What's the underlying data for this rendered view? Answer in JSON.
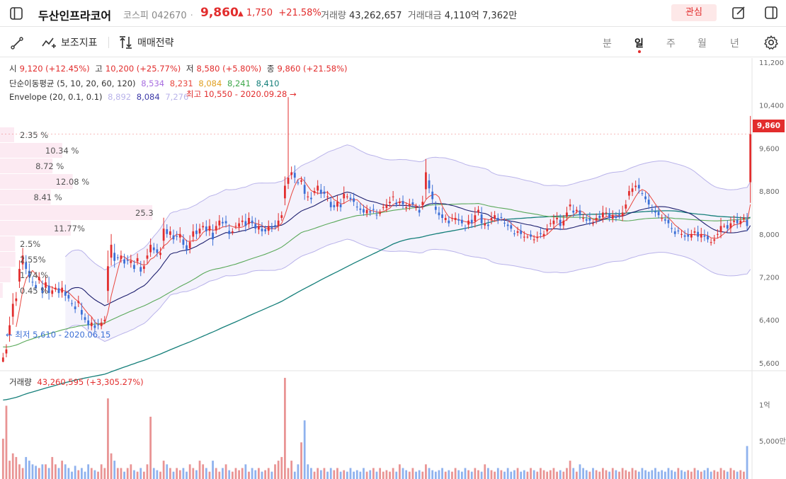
{
  "header": {
    "name": "두산인프라코어",
    "market": "코스피",
    "code": "042670",
    "price": "9,860",
    "change_arrow": "▲",
    "change_amount": "1,750",
    "change_pct": "+21.58%",
    "volume_label": "거래량",
    "volume_value": "43,262,657",
    "amount_label": "거래대금",
    "amount_value": "4,110억 7,362만",
    "fav_label": "관심"
  },
  "toolbar": {
    "indicator_label": "보조지표",
    "strategy_label": "매매전략",
    "periods": [
      "분",
      "일",
      "주",
      "월",
      "년"
    ],
    "active_period": "일"
  },
  "legend": {
    "ohlc": [
      {
        "label": "시",
        "value": "9,120 (+12.45%)"
      },
      {
        "label": "고",
        "value": "10,200 (+25.77%)"
      },
      {
        "label": "저",
        "value": "8,580 (+5.80%)"
      },
      {
        "label": "종",
        "value": "9,860 (+21.58%)"
      }
    ],
    "ma_label": "단순이동평균 (5, 10, 20, 60, 120)",
    "ma_values": [
      "8,534",
      "8,231",
      "8,084",
      "8,241",
      "8,410"
    ],
    "env_label": "Envelope (20, 0.1, 0.1)",
    "env_values": [
      "8,892",
      "8,084",
      "7,276"
    ]
  },
  "annotations": {
    "high": "최고 10,550 - 2020.09.28",
    "low": "최저 5,610 - 2020.06.15",
    "current_price": "9,860",
    "volume_title": "거래량",
    "volume_value": "43,260,595 (+3,305.27%)"
  },
  "colors": {
    "up": "#e22d2d",
    "down": "#3b6fd6",
    "ma5": "#e8473f",
    "ma10": "#1d1f6e",
    "ma20": "#5aa95a",
    "ma60": "#157f7a",
    "envelope": "#b9b3ea",
    "vol_up": "#e99494",
    "vol_down": "#8fb2ee"
  },
  "chart_data": {
    "type": "candlestick",
    "y_axis": {
      "ticks": [
        "11,200",
        "10,400",
        "9,600",
        "8,800",
        "8,000",
        "7,200",
        "6,400",
        "5,600"
      ],
      "range": [
        5400,
        11200
      ]
    },
    "volume_axis": {
      "ticks": [
        "1억",
        "5,000만"
      ]
    },
    "volume_profile": [
      {
        "label": "2.35 %",
        "pct": 2.35
      },
      {
        "label": "10.34 %",
        "pct": 10.34
      },
      {
        "label": "8.72 %",
        "pct": 8.72
      },
      {
        "label": "12.08 %",
        "pct": 12.08
      },
      {
        "label": "8.41 %",
        "pct": 8.41
      },
      {
        "label": "25.3",
        "pct": 25.3
      },
      {
        "label": "11.77%",
        "pct": 11.77
      },
      {
        "label": "2.5%",
        "pct": 2.5
      },
      {
        "label": "2.55%",
        "pct": 2.55
      },
      {
        "label": "1.74 %",
        "pct": 1.74
      },
      {
        "label": "0.45 %",
        "pct": 0.45
      }
    ],
    "ma_series_names": [
      "5",
      "10",
      "20",
      "60",
      "120"
    ],
    "closes": [
      5700,
      5850,
      6300,
      6700,
      6800,
      7350,
      7600,
      7350,
      7200,
      7100,
      7000,
      7200,
      6900,
      7100,
      6900,
      6950,
      7000,
      6900,
      7000,
      6850,
      6800,
      6700,
      6600,
      6750,
      6500,
      6400,
      6300,
      6350,
      6250,
      6300,
      6350,
      6400,
      7400,
      7800,
      7500,
      7550,
      7600,
      7450,
      7500,
      7500,
      7350,
      7550,
      7300,
      7400,
      7600,
      7800,
      7700,
      7650,
      7650,
      8100,
      8000,
      8050,
      7900,
      7950,
      8000,
      7800,
      7700,
      7850,
      8050,
      8000,
      8100,
      8150,
      8050,
      8150,
      7900,
      8150,
      8250,
      8200,
      8200,
      8000,
      8050,
      8150,
      8200,
      8250,
      8150,
      8300,
      8200,
      8100,
      8150,
      8050,
      8050,
      8150,
      8100,
      8150,
      8250,
      8350,
      8900,
      9050,
      9150,
      9050,
      8950,
      9000,
      8750,
      8700,
      8650,
      8800,
      8900,
      8750,
      8750,
      8700,
      8500,
      8500,
      8600,
      8500,
      8750,
      8700,
      8650,
      8600,
      8500,
      8450,
      8400,
      8450,
      8400,
      8450,
      8350,
      8400,
      8500,
      8550,
      8600,
      8700,
      8550,
      8600,
      8550,
      8500,
      8550,
      8550,
      8500,
      8400,
      8600,
      9150,
      8850,
      8650,
      8450,
      8350,
      8300,
      8300,
      8200,
      8300,
      8300,
      8250,
      8200,
      8100,
      8250,
      8200,
      8350,
      8450,
      8200,
      8200,
      8150,
      8300,
      8350,
      8250,
      8300,
      8200,
      8150,
      8100,
      8000,
      8050,
      8000,
      7950,
      7950,
      7950,
      7900,
      7950,
      8000,
      8000,
      8100,
      8200,
      8250,
      8300,
      8150,
      8250,
      8400,
      8550,
      8400,
      8450,
      8350,
      8300,
      8250,
      8250,
      8200,
      8300,
      8300,
      8400,
      8400,
      8300,
      8350,
      8300,
      8350,
      8400,
      8550,
      8800,
      8850,
      8900,
      8850,
      8750,
      8650,
      8550,
      8450,
      8400,
      8350,
      8300,
      8250,
      8200,
      8100,
      8000,
      8050,
      8000,
      7950,
      7950,
      8000,
      8050,
      7950,
      8000,
      7950,
      7900,
      7850,
      7900,
      8000,
      8150,
      8150,
      8100,
      8200,
      8250,
      8200,
      8250,
      8300,
      8150,
      9860
    ],
    "volumes": [
      55,
      100,
      25,
      35,
      30,
      20,
      15,
      30,
      25,
      20,
      18,
      15,
      20,
      20,
      15,
      30,
      20,
      15,
      25,
      20,
      15,
      10,
      18,
      12,
      15,
      10,
      20,
      15,
      12,
      10,
      20,
      15,
      110,
      35,
      25,
      15,
      15,
      10,
      15,
      20,
      12,
      10,
      15,
      10,
      20,
      85,
      15,
      12,
      10,
      25,
      20,
      15,
      10,
      15,
      12,
      15,
      10,
      20,
      15,
      12,
      25,
      20,
      15,
      10,
      25,
      15,
      10,
      15,
      20,
      12,
      10,
      15,
      12,
      15,
      20,
      10,
      15,
      12,
      15,
      10,
      12,
      15,
      10,
      20,
      25,
      30,
      138,
      15,
      25,
      10,
      20,
      50,
      80,
      20,
      15,
      10,
      15,
      12,
      15,
      10,
      15,
      12,
      15,
      10,
      12,
      10,
      15,
      10,
      12,
      10,
      15,
      10,
      12,
      15,
      10,
      15,
      10,
      12,
      10,
      15,
      10,
      20,
      15,
      12,
      10,
      15,
      10,
      12,
      10,
      20,
      15,
      12,
      10,
      12,
      15,
      10,
      12,
      10,
      15,
      12,
      10,
      15,
      12,
      10,
      15,
      12,
      10,
      20,
      15,
      12,
      10,
      15,
      12,
      10,
      15,
      10,
      12,
      15,
      10,
      12,
      10,
      15,
      12,
      10,
      15,
      12,
      10,
      12,
      15,
      10,
      12,
      10,
      15,
      25,
      15,
      10,
      20,
      15,
      12,
      10,
      15,
      12,
      10,
      15,
      12,
      10,
      15,
      12,
      10,
      15,
      12,
      10,
      15,
      12,
      10,
      15,
      12,
      10,
      12,
      15,
      10,
      12,
      10,
      15,
      12,
      10,
      15,
      12,
      10,
      12,
      10,
      15,
      12,
      10,
      12,
      15,
      10,
      12,
      10,
      15,
      12,
      10,
      15,
      12,
      10,
      12,
      10,
      45
    ]
  }
}
